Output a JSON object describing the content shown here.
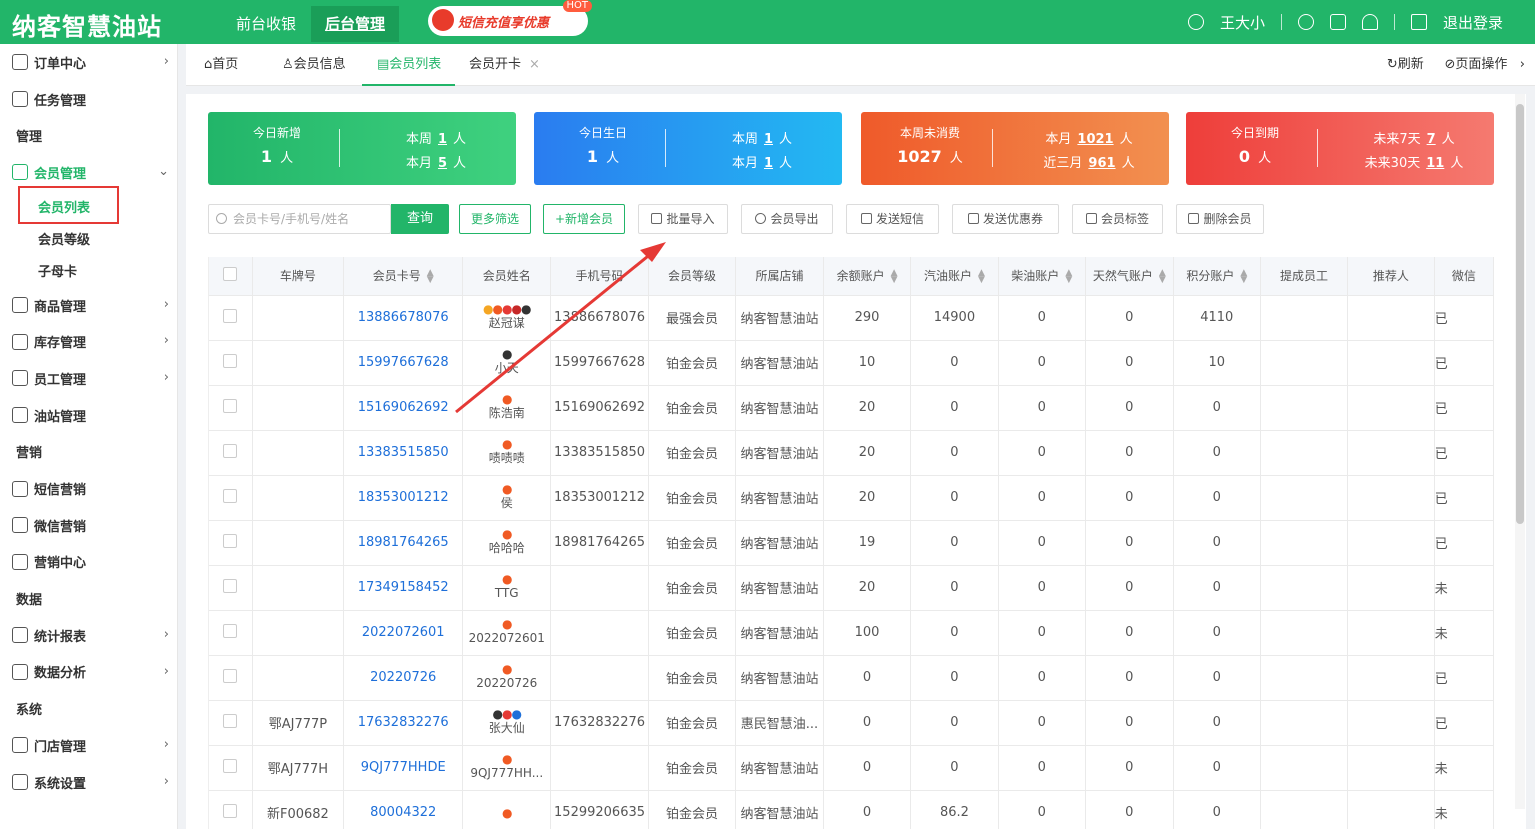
{
  "topbar": {
    "logo": "纳客智慧油站",
    "tab_front": "前台收银",
    "tab_back": "后台管理",
    "promo": "短信充值享优惠",
    "promo_badge": "HOT",
    "user": "王大小",
    "logout": "退出登录"
  },
  "sidebar": {
    "items": [
      {
        "label": "订单中心",
        "type": "item",
        "arrow": true
      },
      {
        "label": "任务管理",
        "type": "item",
        "arrow": false
      },
      {
        "label": "管理",
        "type": "group"
      },
      {
        "label": "会员管理",
        "type": "item",
        "arrow": true,
        "open": true
      },
      {
        "label": "会员列表",
        "type": "sub",
        "active": true
      },
      {
        "label": "会员等级",
        "type": "sub"
      },
      {
        "label": "子母卡",
        "type": "sub"
      },
      {
        "label": "商品管理",
        "type": "item",
        "arrow": true
      },
      {
        "label": "库存管理",
        "type": "item",
        "arrow": true
      },
      {
        "label": "员工管理",
        "type": "item",
        "arrow": true
      },
      {
        "label": "油站管理",
        "type": "item",
        "arrow": false
      },
      {
        "label": "营销",
        "type": "group"
      },
      {
        "label": "短信营销",
        "type": "item",
        "arrow": false
      },
      {
        "label": "微信营销",
        "type": "item",
        "arrow": false
      },
      {
        "label": "营销中心",
        "type": "item",
        "arrow": false
      },
      {
        "label": "数据",
        "type": "group"
      },
      {
        "label": "统计报表",
        "type": "item",
        "arrow": true
      },
      {
        "label": "数据分析",
        "type": "item",
        "arrow": true
      },
      {
        "label": "系统",
        "type": "group"
      },
      {
        "label": "门店管理",
        "type": "item",
        "arrow": true
      },
      {
        "label": "系统设置",
        "type": "item",
        "arrow": true
      }
    ]
  },
  "tabs": {
    "home": "首页",
    "member_info": "会员信息",
    "member_list": "会员列表",
    "member_card": "会员开卡",
    "refresh": "刷新",
    "page_ops": "页面操作"
  },
  "stats": [
    {
      "title": "今日新增",
      "value": "1",
      "unit": "人",
      "r1_label": "本周",
      "r1_value": "1",
      "r2_label": "本月",
      "r2_value": "5",
      "color": "green"
    },
    {
      "title": "今日生日",
      "value": "1",
      "unit": "人",
      "r1_label": "本周",
      "r1_value": "1",
      "r2_label": "本月",
      "r2_value": "1",
      "color": "blue"
    },
    {
      "title": "本周未消费",
      "value": "1027",
      "unit": "人",
      "r1_label": "本月",
      "r1_value": "1021",
      "r2_label": "近三月",
      "r2_value": "961",
      "color": "orange"
    },
    {
      "title": "今日到期",
      "value": "0",
      "unit": "人",
      "r1_label": "未来7天",
      "r1_value": "7",
      "r2_label": "未来30天",
      "r2_value": "11",
      "color": "red"
    }
  ],
  "stat_unit": "人",
  "toolbar": {
    "search_placeholder": "会员卡号/手机号/姓名",
    "query": "查询",
    "more_filter": "更多筛选",
    "add_member": "+新增会员",
    "batch_import": "批量导入",
    "export": "会员导出",
    "send_sms": "发送短信",
    "send_coupon": "发送优惠券",
    "tags": "会员标签",
    "delete": "删除会员"
  },
  "table": {
    "headers": [
      "车牌号",
      "会员卡号",
      "会员姓名",
      "手机号码",
      "会员等级",
      "所属店铺",
      "余额账户",
      "汽油账户",
      "柴油账户",
      "天然气账户",
      "积分账户",
      "提成员工",
      "推荐人",
      "微信"
    ],
    "rows": [
      {
        "plate": "",
        "card": "13886678076",
        "dots": "●●●●●",
        "dotcolor": "multi",
        "name": "赵冠谋",
        "phone": "13886678076",
        "level": "最强会员",
        "store": "纳客智慧油站",
        "balance": "290",
        "gas": "14900",
        "diesel": "0",
        "ng": "0",
        "points": "4110",
        "staff": "",
        "ref": "",
        "wx": "已"
      },
      {
        "plate": "",
        "card": "15997667628",
        "dots": "●",
        "dotcolor": "dark",
        "name": "小天",
        "phone": "15997667628",
        "level": "铂金会员",
        "store": "纳客智慧油站",
        "balance": "10",
        "gas": "0",
        "diesel": "0",
        "ng": "0",
        "points": "10",
        "staff": "",
        "ref": "",
        "wx": "已"
      },
      {
        "plate": "",
        "card": "15169062692",
        "dots": "●",
        "dotcolor": "orange",
        "name": "陈浩南",
        "phone": "15169062692",
        "level": "铂金会员",
        "store": "纳客智慧油站",
        "balance": "20",
        "gas": "0",
        "diesel": "0",
        "ng": "0",
        "points": "0",
        "staff": "",
        "ref": "",
        "wx": "已"
      },
      {
        "plate": "",
        "card": "13383515850",
        "dots": "●",
        "dotcolor": "orange",
        "name": "啧啧啧",
        "phone": "13383515850",
        "level": "铂金会员",
        "store": "纳客智慧油站",
        "balance": "20",
        "gas": "0",
        "diesel": "0",
        "ng": "0",
        "points": "0",
        "staff": "",
        "ref": "",
        "wx": "已"
      },
      {
        "plate": "",
        "card": "18353001212",
        "dots": "●",
        "dotcolor": "orange",
        "name": "侯",
        "phone": "18353001212",
        "level": "铂金会员",
        "store": "纳客智慧油站",
        "balance": "20",
        "gas": "0",
        "diesel": "0",
        "ng": "0",
        "points": "0",
        "staff": "",
        "ref": "",
        "wx": "已"
      },
      {
        "plate": "",
        "card": "18981764265",
        "dots": "●",
        "dotcolor": "orange",
        "name": "哈哈哈",
        "phone": "18981764265",
        "level": "铂金会员",
        "store": "纳客智慧油站",
        "balance": "19",
        "gas": "0",
        "diesel": "0",
        "ng": "0",
        "points": "0",
        "staff": "",
        "ref": "",
        "wx": "已"
      },
      {
        "plate": "",
        "card": "17349158452",
        "dots": "●",
        "dotcolor": "orange",
        "name": "TTG",
        "phone": "",
        "level": "铂金会员",
        "store": "纳客智慧油站",
        "balance": "20",
        "gas": "0",
        "diesel": "0",
        "ng": "0",
        "points": "0",
        "staff": "",
        "ref": "",
        "wx": "未"
      },
      {
        "plate": "",
        "card": "2022072601",
        "dots": "●",
        "dotcolor": "orange",
        "name": "2022072601",
        "phone": "",
        "level": "铂金会员",
        "store": "纳客智慧油站",
        "balance": "100",
        "gas": "0",
        "diesel": "0",
        "ng": "0",
        "points": "0",
        "staff": "",
        "ref": "",
        "wx": "未"
      },
      {
        "plate": "",
        "card": "20220726",
        "dots": "●",
        "dotcolor": "orange",
        "name": "20220726",
        "phone": "",
        "level": "铂金会员",
        "store": "纳客智慧油站",
        "balance": "0",
        "gas": "0",
        "diesel": "0",
        "ng": "0",
        "points": "0",
        "staff": "",
        "ref": "",
        "wx": "已"
      },
      {
        "plate": "鄂AJ777P",
        "card": "17632832276",
        "dots": "●●●",
        "dotcolor": "mix3",
        "name": "张大仙",
        "phone": "17632832276",
        "level": "铂金会员",
        "store": "惠民智慧油...",
        "balance": "0",
        "gas": "0",
        "diesel": "0",
        "ng": "0",
        "points": "0",
        "staff": "",
        "ref": "",
        "wx": "已"
      },
      {
        "plate": "鄂AJ777H",
        "card": "9QJ777HHDE",
        "dots": "●",
        "dotcolor": "orange",
        "name": "9QJ777HH...",
        "phone": "",
        "level": "铂金会员",
        "store": "纳客智慧油站",
        "balance": "0",
        "gas": "0",
        "diesel": "0",
        "ng": "0",
        "points": "0",
        "staff": "",
        "ref": "",
        "wx": "未"
      },
      {
        "plate": "新F00682",
        "card": "80004322",
        "dots": "●",
        "dotcolor": "orange",
        "name": "",
        "phone": "15299206635",
        "level": "铂金会员",
        "store": "纳客智慧油站",
        "balance": "0",
        "gas": "86.2",
        "diesel": "0",
        "ng": "0",
        "points": "0",
        "staff": "",
        "ref": "",
        "wx": "未"
      }
    ]
  },
  "colors": {
    "brand": "#22b569",
    "stat_green": "#2fbd6a",
    "stat_blue": "#2a8cf0",
    "stat_orange": "#ef6f3a",
    "stat_red": "#ee4a40",
    "link": "#1e6fd9",
    "annotation": "#e53935"
  }
}
